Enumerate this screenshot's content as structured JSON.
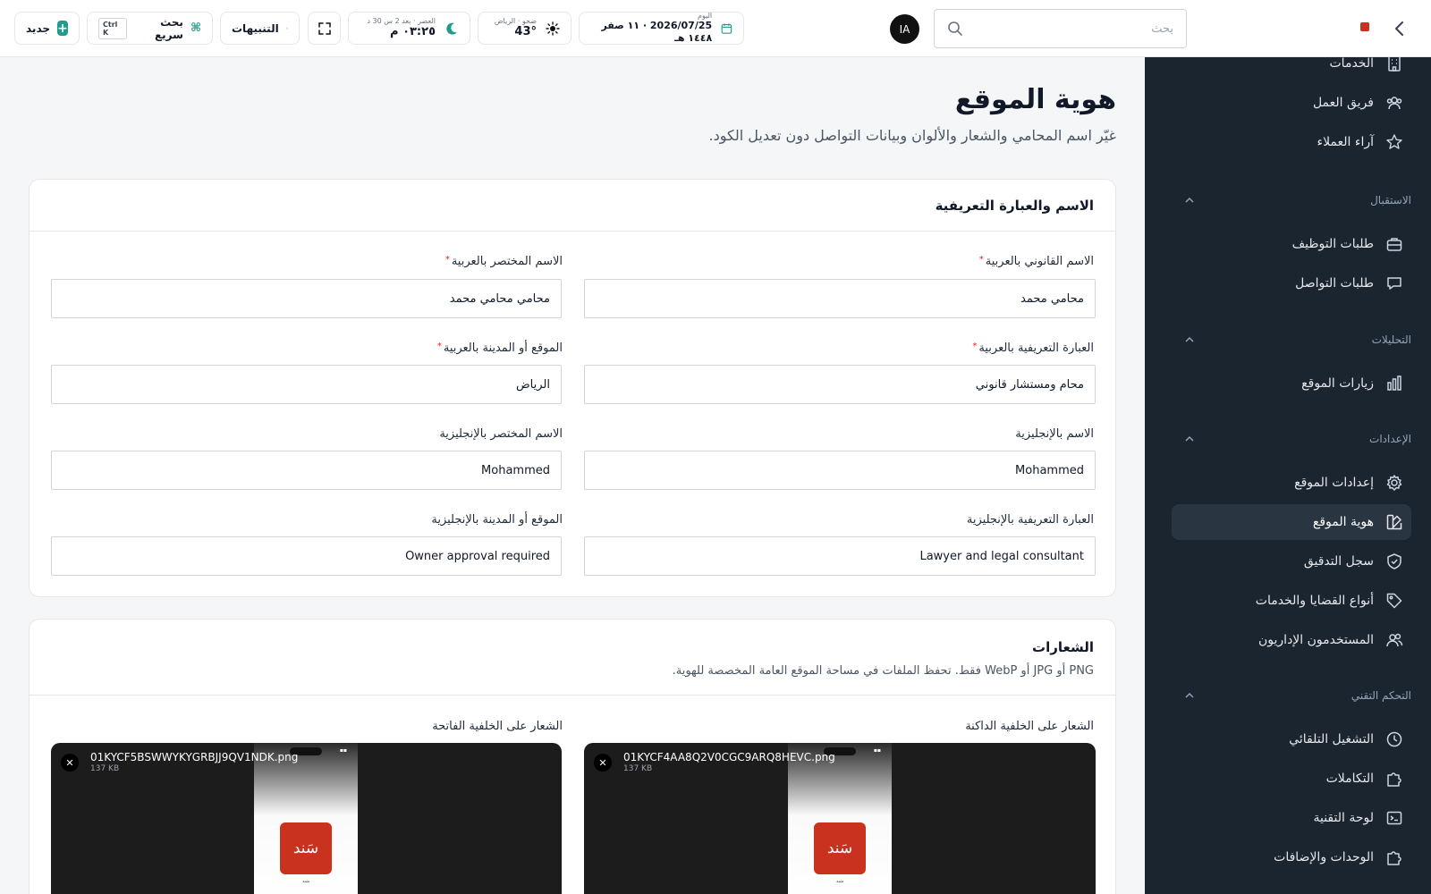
{
  "header": {
    "search_placeholder": "بحث",
    "avatar_initials": "IA",
    "date": {
      "label": "اليوم",
      "value": "2026/07/25 · ١١ صفر ١٤٤٨ هـ"
    },
    "weather": {
      "label": "ضحو · الرياض",
      "value": "43°"
    },
    "prayer": {
      "label": "العصر · بعد 2 س 30 د",
      "value": "٠٣:٢٥ م"
    },
    "notifications_label": "التنبيهات",
    "quick_search": {
      "label": "بحث سريع",
      "shortcut": "Ctrl K"
    },
    "new_label": "جديد"
  },
  "sidebar": {
    "items_top": [
      {
        "label": "الخدمات"
      },
      {
        "label": "فريق العمل"
      },
      {
        "label": "آراء العملاء"
      }
    ],
    "group_reception": "الاستقبال",
    "reception_items": [
      {
        "label": "طلبات التوظيف"
      },
      {
        "label": "طلبات التواصل"
      }
    ],
    "group_analytics": "التحليلات",
    "analytics_items": [
      {
        "label": "زيارات الموقع"
      }
    ],
    "group_settings": "الإعدادات",
    "settings_items": [
      {
        "label": "إعدادات الموقع"
      },
      {
        "label": "هوية الموقع"
      },
      {
        "label": "سجل التدقيق"
      },
      {
        "label": "أنواع القضايا والخدمات"
      },
      {
        "label": "المستخدمون الإداريون"
      }
    ],
    "group_tech": "التحكم التقني",
    "tech_items": [
      {
        "label": "التشغيل التلقائي"
      },
      {
        "label": "التكاملات"
      },
      {
        "label": "لوحة التقنية"
      },
      {
        "label": "الوحدات والإضافات"
      }
    ]
  },
  "page": {
    "title": "هوية الموقع",
    "subtitle": "غيّر اسم المحامي والشعار والألوان وبيانات التواصل دون تعديل الكود."
  },
  "name_card": {
    "title": "الاسم والعبارة التعريفية",
    "fields": {
      "legal_name_ar": {
        "label": "الاسم القانوني بالعربية",
        "value": "محامي محمد"
      },
      "short_name_ar": {
        "label": "الاسم المختصر بالعربية",
        "value": "محامي محامي محمد"
      },
      "tagline_ar": {
        "label": "العبارة التعريفية بالعربية",
        "value": "محام ومستشار قانوني"
      },
      "city_ar": {
        "label": "الموقع أو المدينة بالعربية",
        "value": "الرياض"
      },
      "name_en": {
        "label": "الاسم بالإنجليزية",
        "value": "Mohammed"
      },
      "short_name_en": {
        "label": "الاسم المختصر بالإنجليزية",
        "value": "Mohammed"
      },
      "tagline_en": {
        "label": "العبارة التعريفية بالإنجليزية",
        "value": "Lawyer and legal consultant"
      },
      "city_en": {
        "label": "الموقع أو المدينة بالإنجليزية",
        "value": "Owner approval required"
      }
    }
  },
  "logos_card": {
    "title": "الشعارات",
    "description": "PNG أو JPG أو WebP فقط. تحفظ الملفات في مساحة الموقع العامة المخصصة للهوية.",
    "dark": {
      "label": "الشعار على الخلفية الداكنة",
      "file_name": "01KYCF4AA8Q2V0CGC9ARQ8HEVC.png",
      "file_size": "137 KB",
      "brand_text": "سَند"
    },
    "light": {
      "label": "الشعار على الخلفية الفاتحة",
      "file_name": "01KYCF5BSWWYKYGRBJJ9QV1NDK.png",
      "file_size": "137 KB",
      "brand_text": "سَند"
    }
  },
  "colors": {
    "accent": "#1f9d8a",
    "sidebar_bg": "#1b2530",
    "brand_red": "#c8321e",
    "required": "#dc2626"
  },
  "icons": [
    "chevron-right-icon",
    "search-icon",
    "calendar-icon",
    "sun-icon",
    "moon-icon",
    "expand-icon",
    "bell-icon",
    "command-icon",
    "plus-icon"
  ]
}
